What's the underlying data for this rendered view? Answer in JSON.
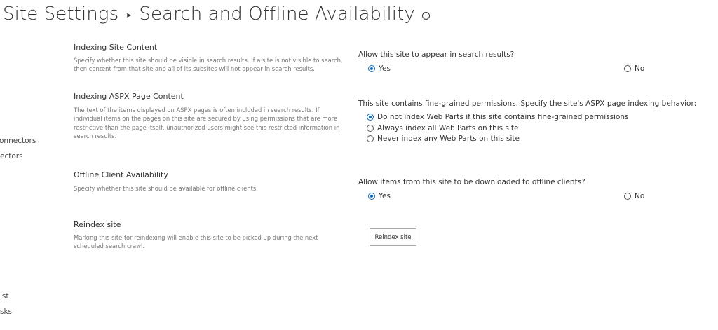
{
  "header": {
    "parent_title": "Site Settings",
    "separator": "▸",
    "page_title": "Search and Offline Availability"
  },
  "left_nav": {
    "fragments": [
      "onnectors",
      "ectors",
      "ist",
      "sks"
    ]
  },
  "sections": {
    "indexing_site_content": {
      "heading": "Indexing Site Content",
      "description": "Specify whether this site should be visible in search results. If a site is not visible to search, then content from that site and all of its subsites will not appear in search results.",
      "question": "Allow this site to appear in search results?",
      "options": [
        {
          "label": "Yes",
          "checked": true
        },
        {
          "label": "No",
          "checked": false
        }
      ]
    },
    "indexing_aspx": {
      "heading": "Indexing ASPX Page Content",
      "description": "The text of the items displayed on ASPX pages is often included in search results. If individual items on the pages on this site are secured by using permissions that are more restrictive than the page itself, unauthorized users might see this restricted information in search results.",
      "question": "This site contains fine-grained permissions. Specify the site's ASPX page indexing behavior:",
      "options": [
        {
          "label": "Do not index Web Parts if this site contains fine-grained permissions",
          "checked": true
        },
        {
          "label": "Always index all Web Parts on this site",
          "checked": false
        },
        {
          "label": "Never index any Web Parts on this site",
          "checked": false
        }
      ]
    },
    "offline_client": {
      "heading": "Offline Client Availability",
      "description": "Specify whether this site should be available for offline clients.",
      "question": "Allow items from this site to be downloaded to offline clients?",
      "options": [
        {
          "label": "Yes",
          "checked": true
        },
        {
          "label": "No",
          "checked": false
        }
      ]
    },
    "reindex": {
      "heading": "Reindex site",
      "description": "Marking this site for reindexing will enable this site to be picked up during the next scheduled search crawl.",
      "button_label": "Reindex site"
    }
  },
  "colors": {
    "radio_accent": "#0f6cbd",
    "description_text": "#777777",
    "body_text": "#333333"
  }
}
